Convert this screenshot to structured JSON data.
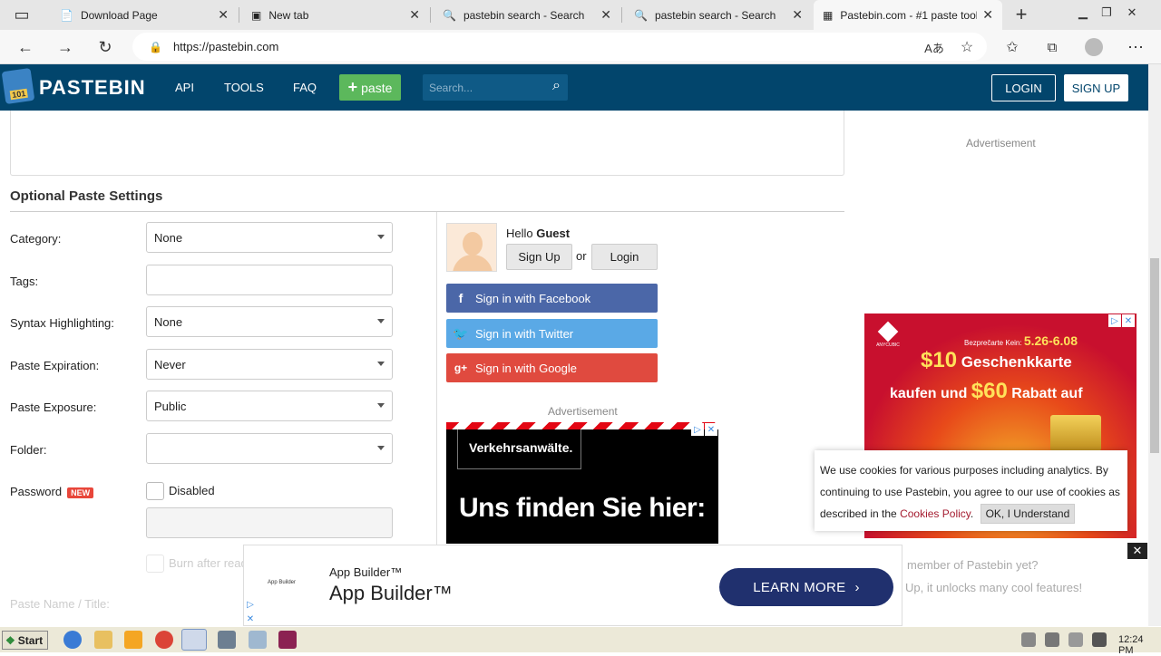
{
  "browser": {
    "tabs": [
      {
        "title": "Download Page",
        "icon": "page-icon"
      },
      {
        "title": "New tab",
        "icon": "newtab-icon"
      },
      {
        "title": "pastebin search - Search",
        "icon": "search-icon"
      },
      {
        "title": "pastebin search - Search",
        "icon": "search-icon"
      },
      {
        "title": "Pastebin.com - #1 paste tool",
        "icon": "pastebin-icon"
      }
    ],
    "url": "https://pastebin.com"
  },
  "header": {
    "brand": "PASTEBIN",
    "nav": [
      "API",
      "TOOLS",
      "FAQ"
    ],
    "paste_button": "paste",
    "search_placeholder": "Search...",
    "login": "LOGIN",
    "signup": "SIGN UP",
    "colors": {
      "bar": "#02456c",
      "paste": "#5cb85c"
    }
  },
  "settings": {
    "title": "Optional Paste Settings",
    "category": {
      "label": "Category:",
      "value": "None"
    },
    "tags": {
      "label": "Tags:",
      "value": ""
    },
    "syntax": {
      "label": "Syntax Highlighting:",
      "value": "None"
    },
    "expiration": {
      "label": "Paste Expiration:",
      "value": "Never"
    },
    "exposure": {
      "label": "Paste Exposure:",
      "value": "Public"
    },
    "folder": {
      "label": "Folder:",
      "value": ""
    },
    "password": {
      "label": "Password",
      "badge": "NEW",
      "toggle": "Disabled"
    },
    "burn": "Burn after read",
    "paste_name": "Paste Name / Title:"
  },
  "user_panel": {
    "hello": "Hello",
    "guest": "Guest",
    "signup": "Sign Up",
    "or": "or",
    "login": "Login",
    "facebook": "Sign in with Facebook",
    "twitter": "Sign in with Twitter",
    "google": "Sign in with Google",
    "colors": {
      "facebook": "#4b67a8",
      "twitter": "#5aa9e6",
      "google": "#e04a3f"
    },
    "member_question": "member of Pastebin yet?",
    "member_line": "Up, it unlocks many cool features!"
  },
  "ads": {
    "label": "Advertisement",
    "ad1": {
      "box": "Verkehrsanwälte.",
      "headline": "Uns finden Sie hier:"
    },
    "ad2": {
      "line1_prefix": "Bezprečarte Kein:",
      "line1_dates": "5.26-6.08",
      "line2_amount": "$10",
      "line2_text": "Geschenkkarte",
      "line3_a": "kaufen und",
      "line3_amount": "$60",
      "line3_b": "Rabatt auf",
      "brand": "ANYCUBIC"
    },
    "bottom": {
      "mini": "App Builder",
      "small": "App Builder™",
      "big": "App Builder™",
      "cta": "LEARN MORE"
    }
  },
  "cookie": {
    "text1": "We use cookies for various purposes including analytics. By continuing to use Pastebin, you agree to our use of cookies as described in the",
    "link": "Cookies Policy",
    "button": "OK, I Understand"
  },
  "taskbar": {
    "start": "Start",
    "time": "12:24 PM"
  }
}
